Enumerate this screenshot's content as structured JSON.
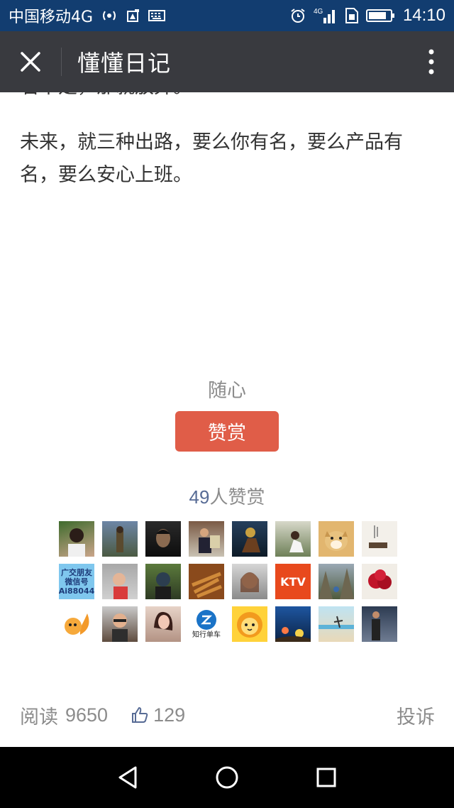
{
  "status_bar": {
    "carrier": "中国移动4G",
    "network_badge": "4G",
    "time": "14:10",
    "icons": [
      "hotspot-icon",
      "notification-icon",
      "keyboard-icon",
      "alarm-icon",
      "signal-icon",
      "sim-icon",
      "battery-icon"
    ]
  },
  "title_bar": {
    "title": "懂懂日记",
    "close_icon": "close-icon",
    "more_icon": "more-vertical-icon"
  },
  "article": {
    "paragraphs": [
      "若不是，那就放弃。",
      "未来，就三种出路，要么你有名，要么产品有名，要么安心上班。"
    ]
  },
  "reward": {
    "author": "随心",
    "button_label": "赞赏",
    "count": "49",
    "count_suffix": "人赞赏",
    "avatar_texts": {
      "wechat_ad": "广交朋友\n微信号\nAi88044",
      "ktv": "KTV",
      "bike": "知行单车"
    },
    "colors": {
      "button": "#e05d48",
      "count": "#576b95"
    }
  },
  "footer": {
    "read_label": "阅读",
    "read_count": "9650",
    "like_count": "129",
    "like_icon": "thumbs-up-icon",
    "report_label": "投诉"
  },
  "nav_bar": {
    "back_icon": "back-icon",
    "home_icon": "home-icon",
    "recents_icon": "recents-icon"
  }
}
